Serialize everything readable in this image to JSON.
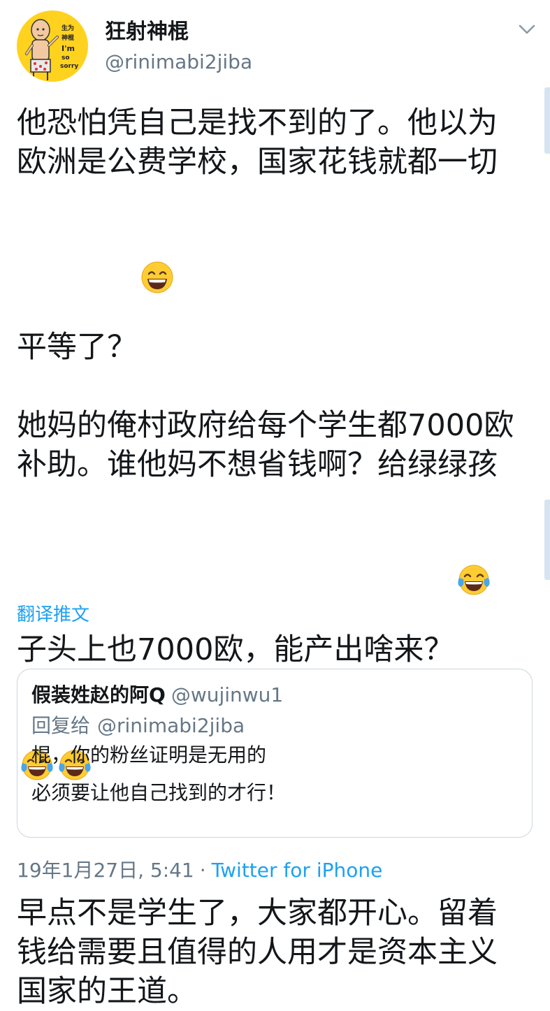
{
  "author": {
    "display_name": "狂射神棍",
    "handle": "@rinimabi2jiba",
    "avatar_text": [
      "生为",
      "神棍",
      "I'm",
      "so",
      "sorry"
    ]
  },
  "tweet": {
    "paragraphs": [
      "他恐怕凭自己是找不到的了。他以为欧洲是公费学校，国家花钱就都一切平等了？",
      "她妈的俺村政府给每个学生都7000欧补助。谁他妈不想省钱啊？给绿绿孩子头上也7000欧，能产出啥来？",
      "早点不是学生了，大家都开心。留着钱给需要且值得的人用才是资本主义国家的王道。"
    ],
    "emojis": {
      "p1": [
        "grinning-face"
      ],
      "p2": [
        "tears-of-joy-face",
        "tears-of-joy-face",
        "tears-of-joy-face"
      ]
    },
    "translate_label": "翻译推文"
  },
  "quoted_tweet": {
    "display_name": "假装姓赵的阿Q",
    "handle": "@wujinwu1",
    "reply_prefix": "回复给",
    "reply_to": "@rinimabi2jiba",
    "line1": "棍，你的粉丝证明是无用的",
    "line2": "必须要让他自己找到的才行！"
  },
  "meta": {
    "timestamp": "19年1月27日, 5:41",
    "separator": "·",
    "source": "Twitter for iPhone"
  },
  "colors": {
    "accent": "#1da1f2",
    "secondary_text": "#657786",
    "primary_text": "#14171a",
    "border": "#ccd6dd",
    "avatar_bg": "#ffd21f"
  }
}
